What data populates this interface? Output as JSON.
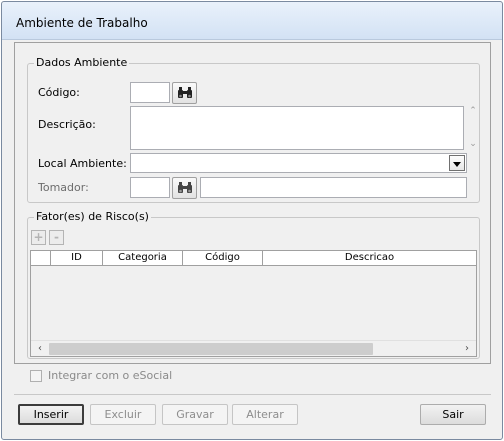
{
  "window": {
    "title": "Ambiente de Trabalho"
  },
  "dados": {
    "group_label": "Dados Ambiente",
    "codigo_label": "Código:",
    "codigo_value": "",
    "descricao_label": "Descrição:",
    "descricao_value": "",
    "local_label": "Local Ambiente:",
    "local_value": "",
    "tomador_label": "Tomador:",
    "tomador_code": "",
    "tomador_name": ""
  },
  "fatores": {
    "group_label": "Fator(es) de Risco(s)",
    "add_label": "+",
    "remove_label": "-",
    "columns": [
      "",
      "ID",
      "Categoria",
      "Código",
      "Descricao"
    ],
    "rows": []
  },
  "esocial": {
    "label": "Integrar com o eSocial",
    "checked": false
  },
  "buttons": {
    "inserir": "Inserir",
    "excluir": "Excluir",
    "gravar": "Gravar",
    "alterar": "Alterar",
    "sair": "Sair"
  },
  "icons": {
    "search": "binoculars-icon",
    "scroll_left": "‹",
    "scroll_right": "›",
    "up": "⌃",
    "down": "⌄"
  }
}
